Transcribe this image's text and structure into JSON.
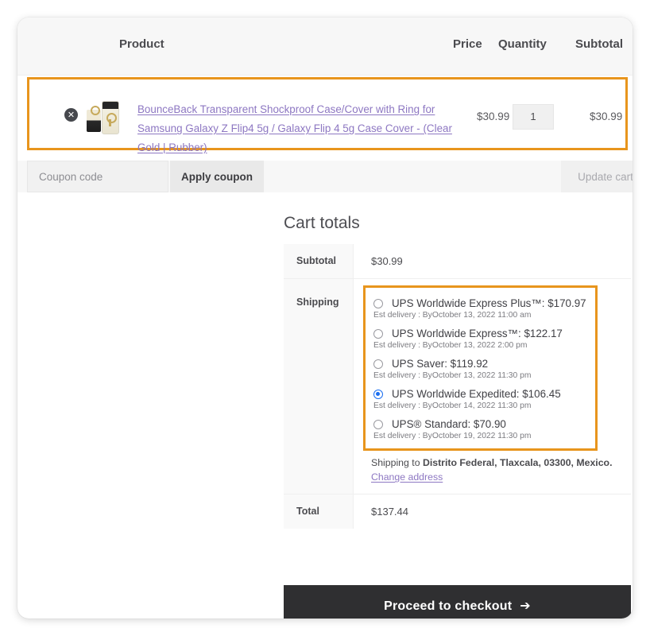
{
  "cart_table": {
    "headers": {
      "product": "Product",
      "price": "Price",
      "quantity": "Quantity",
      "subtotal": "Subtotal"
    },
    "items": [
      {
        "remove_icon": "remove-circle-x-icon",
        "thumbnail": "product-thumbnail-phone-case",
        "title": "BounceBack Transparent Shockproof Case/Cover with Ring for Samsung Galaxy Z Flip4 5g / Galaxy Flip 4 5g Case Cover - (Clear Gold | Rubber)",
        "price": "$30.99",
        "quantity": "1",
        "subtotal": "$30.99"
      }
    ]
  },
  "coupon": {
    "placeholder": "Coupon code",
    "value": "",
    "apply_label": "Apply coupon",
    "update_cart_label": "Update cart"
  },
  "cart_totals": {
    "title": "Cart totals",
    "subtotal_label": "Subtotal",
    "subtotal_value": "$30.99",
    "shipping_label": "Shipping",
    "shipping_options": [
      {
        "label": "UPS Worldwide Express Plus™: $170.97",
        "est": "Est delivery : ByOctober 13, 2022 11:00 am",
        "selected": false
      },
      {
        "label": "UPS Worldwide Express™: $122.17",
        "est": "Est delivery : ByOctober 13, 2022 2:00 pm",
        "selected": false
      },
      {
        "label": "UPS Saver: $119.92",
        "est": "Est delivery : ByOctober 13, 2022 11:30 pm",
        "selected": false
      },
      {
        "label": "UPS Worldwide Expedited: $106.45",
        "est": "Est delivery : ByOctober 14, 2022 11:30 pm",
        "selected": true
      },
      {
        "label": "UPS® Standard: $70.90",
        "est": "Est delivery : ByOctober 19, 2022 11:30 pm",
        "selected": false
      }
    ],
    "shipping_to_prefix": "Shipping to ",
    "shipping_to_address": "Distrito Federal, Tlaxcala, 03300, Mexico.",
    "change_address_label": "Change address",
    "total_label": "Total",
    "total_value": "$137.44"
  },
  "checkout": {
    "label": "Proceed to checkout",
    "arrow": "➔"
  },
  "colors": {
    "highlight": "#e8951d",
    "link": "#8d77c2",
    "selected_radio": "#1a6ef0",
    "checkout_bg": "#2f2f31"
  }
}
